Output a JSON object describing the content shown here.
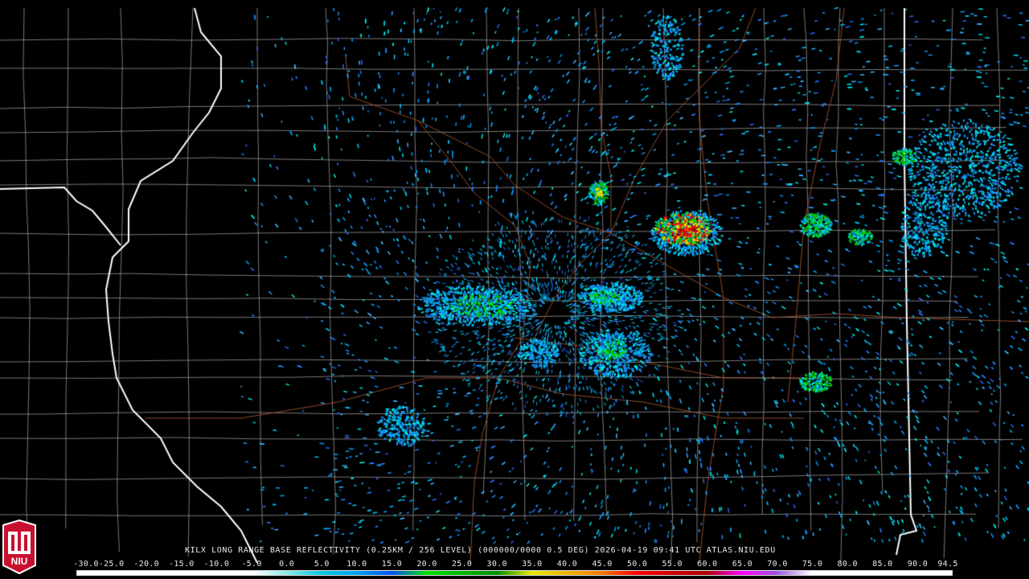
{
  "product": {
    "caption": "KILX LONG RANGE BASE REFLECTIVITY (0.25KM / 256 LEVEL) (000000/0000 0.5 DEG) 2026-04-19 09:41 UTC  ATLAS.NIU.EDU",
    "logo_text": "NIU",
    "logo_color": "#c8102e"
  },
  "color_scale": {
    "ticks": [
      "-30.0",
      "-25.0",
      "-20.0",
      "-15.0",
      "-10.0",
      "-5.0",
      "0.0",
      "5.0",
      "10.0",
      "15.0",
      "20.0",
      "25.0",
      "30.0",
      "35.0",
      "40.0",
      "45.0",
      "50.0",
      "55.0",
      "60.0",
      "65.0",
      "70.0",
      "75.0",
      "80.0",
      "85.0",
      "90.0",
      "94.5"
    ],
    "colors": [
      "#ffffff",
      "#ffffff",
      "#ffffff",
      "#ffffff",
      "#ffffff",
      "#ffffff",
      "#8ae6e6",
      "#00c8e0",
      "#00a0f0",
      "#0050f0",
      "#00e000",
      "#00b400",
      "#009000",
      "#e8e800",
      "#f0b400",
      "#f07800",
      "#ff0000",
      "#d00000",
      "#a80000",
      "#ff00ff",
      "#9955dd",
      "#ffffff",
      "#ffffff",
      "#ffffff",
      "#ffffff",
      "#ffffff"
    ]
  },
  "map_colors": {
    "county_lines": "#a8a8a8",
    "state_lines": "#ffffff",
    "highways": "#a0522d",
    "background": "#000000"
  }
}
